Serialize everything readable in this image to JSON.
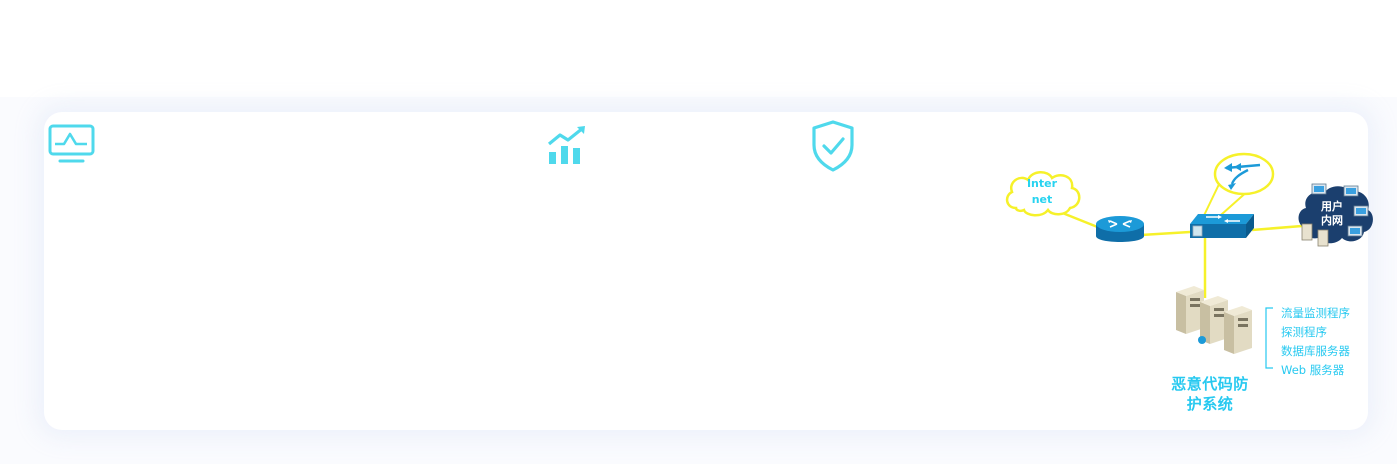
{
  "colors": {
    "icon": "#4fd9ec",
    "link": "#f6f12a",
    "label": "#27c9f0",
    "device": "#1c8fd0"
  },
  "features": [
    {
      "icon": "monitor-icon"
    },
    {
      "icon": "trend-chart-icon"
    },
    {
      "icon": "shield-check-icon"
    }
  ],
  "diagram": {
    "internet_line1": "Inter",
    "internet_line2": "net",
    "intranet_line1": "用户",
    "intranet_line2": "内网",
    "system_line1": "恶意代码防",
    "system_line2": "护系统",
    "components": [
      "流量监测程序",
      "探测程序",
      "数据库服务器",
      "Web 服务器"
    ]
  }
}
